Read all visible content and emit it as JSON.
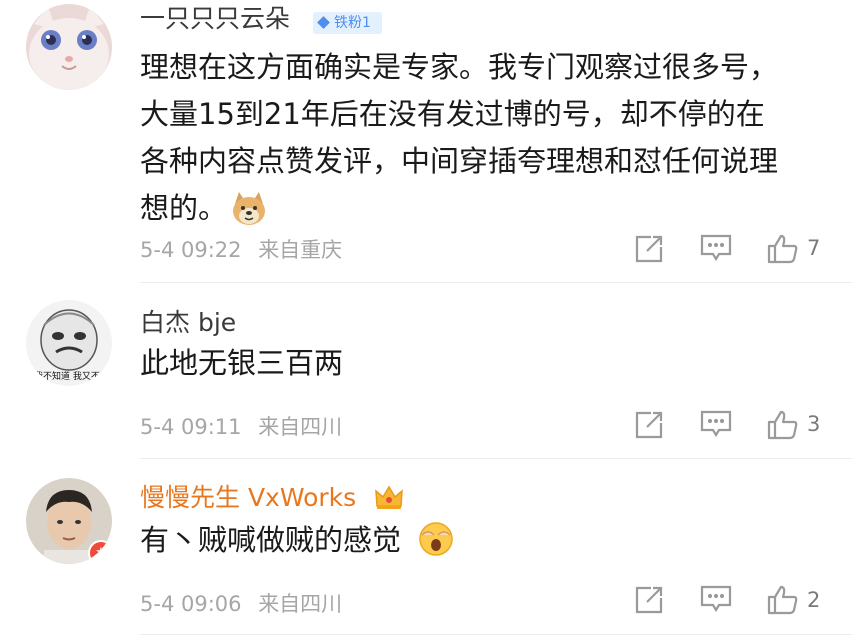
{
  "comments": [
    {
      "username": "一只只只云朵",
      "badge": "铁粉1",
      "text_lines": [
        "理想在这方面确实是专家。我专门观察过很多号，",
        "大量15到21年后在没有发过博的号，却不停的在",
        "各种内容点赞发评，中间穿插夸理想和怼任何说理",
        "想的。"
      ],
      "date": "5-4 09:22",
      "location": "来自重庆",
      "likes": "7",
      "avatar_icon": "white-cat-avatar",
      "emoji_icon": "doge-emoji"
    },
    {
      "username": "白杰 bje",
      "avatar_caption": "我不知道 我又不问",
      "text_lines": [
        "此地无银三百两"
      ],
      "date": "5-4 09:11",
      "location": "来自四川",
      "likes": "3",
      "avatar_icon": "meme-face-avatar"
    },
    {
      "username": "慢慢先生 VxWorks",
      "text_lines": [
        "有丶贼喊做贼的感觉"
      ],
      "date": "5-4 09:06",
      "location": "来自四川",
      "likes": "2",
      "avatar_icon": "man-photo-avatar",
      "emoji_icon": "shocked-face-emoji",
      "name_color": "#e8781f"
    }
  ],
  "colors": {
    "accent_vip": "#e8781f",
    "badge_bg": "#e3f0fe",
    "badge_text": "#4e8ef0",
    "meta": "#a6a6a6"
  }
}
